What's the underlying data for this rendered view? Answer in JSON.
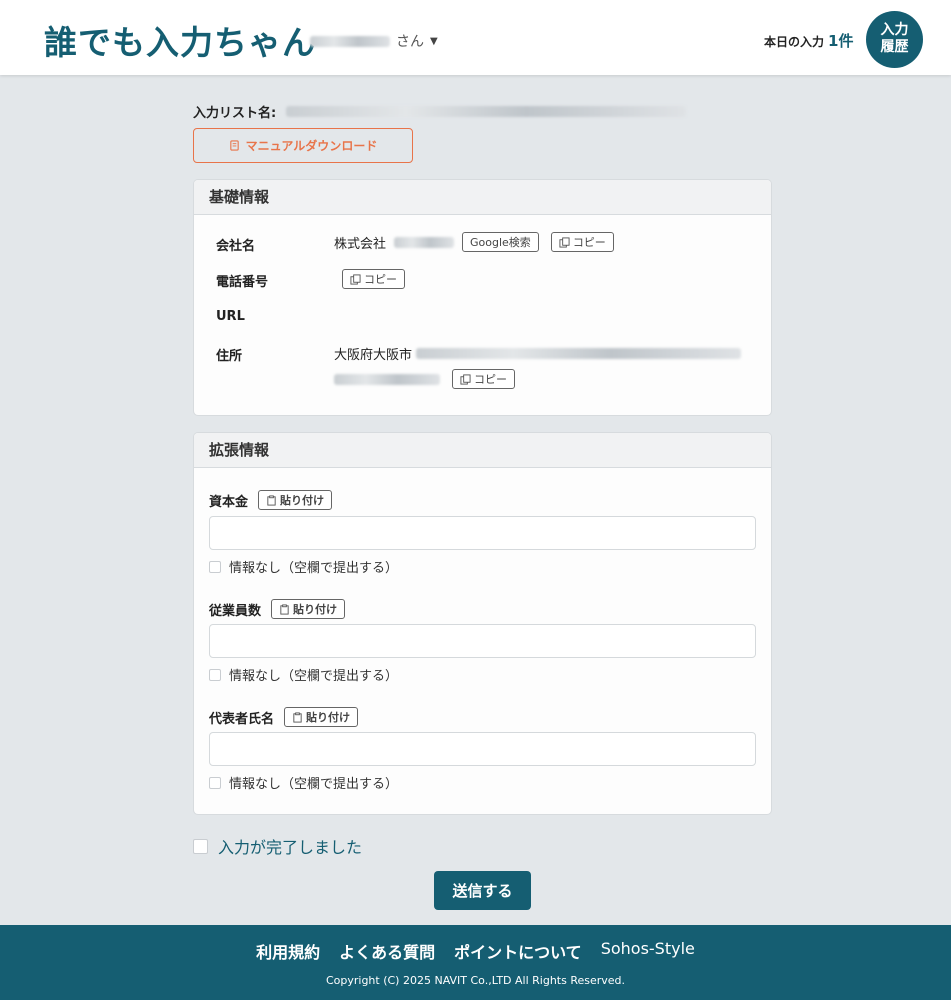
{
  "header": {
    "brand": "誰でも入力ちゃん",
    "user_suffix": "さん",
    "today_label": "本日の入力",
    "today_count": "1件",
    "history_line1": "入力",
    "history_line2": "履歴"
  },
  "list": {
    "label": "入力リスト名:",
    "manual_button": "マニュアルダウンロード"
  },
  "basic": {
    "title": "基礎情報",
    "company_label": "会社名",
    "company_value": "株式会社",
    "google_button": "Google検索",
    "copy_label": "コピー",
    "phone_label": "電話番号",
    "url_label": "URL",
    "address_label": "住所",
    "address_value": "大阪府大阪市"
  },
  "extended": {
    "title": "拡張情報",
    "paste_label": "貼り付け",
    "no_info_label": "情報なし（空欄で提出する）",
    "fields": [
      {
        "label": "資本金",
        "value": ""
      },
      {
        "label": "従業員数",
        "value": ""
      },
      {
        "label": "代表者氏名",
        "value": ""
      }
    ]
  },
  "form": {
    "done_label": "入力が完了しました",
    "submit_label": "送信する"
  },
  "footer": {
    "links": [
      "利用規約",
      "よくある質問",
      "ポイントについて",
      "Sohos-Style"
    ],
    "copyright": "Copyright (C) 2025 NAVIT Co.,LTD All Rights Reserved."
  },
  "colors": {
    "primary": "#155e72",
    "accent": "#e8744a",
    "background": "#e3e7ea"
  }
}
